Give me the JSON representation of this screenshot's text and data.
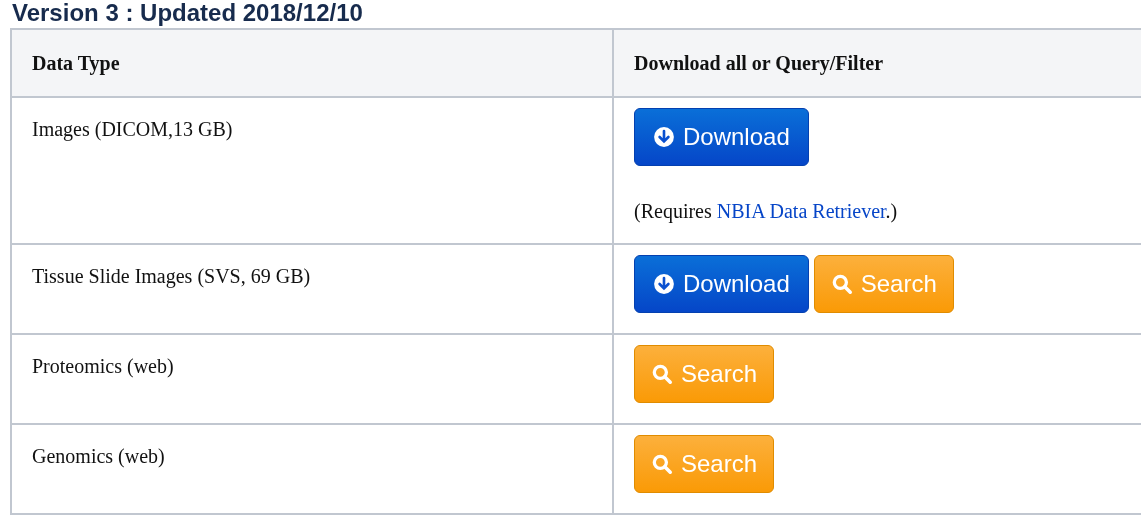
{
  "heading": "Version 3 : Updated 2018/12/10",
  "table": {
    "columns": [
      "Data Type",
      "Download all or Query/Filter"
    ],
    "rows": [
      {
        "data_type": "Images (DICOM,13 GB)",
        "buttons": [
          {
            "kind": "download",
            "label": "Download"
          }
        ],
        "note": {
          "before": "(Requires ",
          "link": "NBIA Data Retriever",
          "after": ".)"
        }
      },
      {
        "data_type": "Tissue Slide Images (SVS, 69 GB)",
        "buttons": [
          {
            "kind": "download",
            "label": "Download"
          },
          {
            "kind": "search",
            "label": "Search"
          }
        ]
      },
      {
        "data_type": "Proteomics (web)",
        "buttons": [
          {
            "kind": "search",
            "label": "Search"
          }
        ]
      },
      {
        "data_type": "Genomics (web)",
        "buttons": [
          {
            "kind": "search",
            "label": "Search"
          }
        ]
      }
    ]
  }
}
